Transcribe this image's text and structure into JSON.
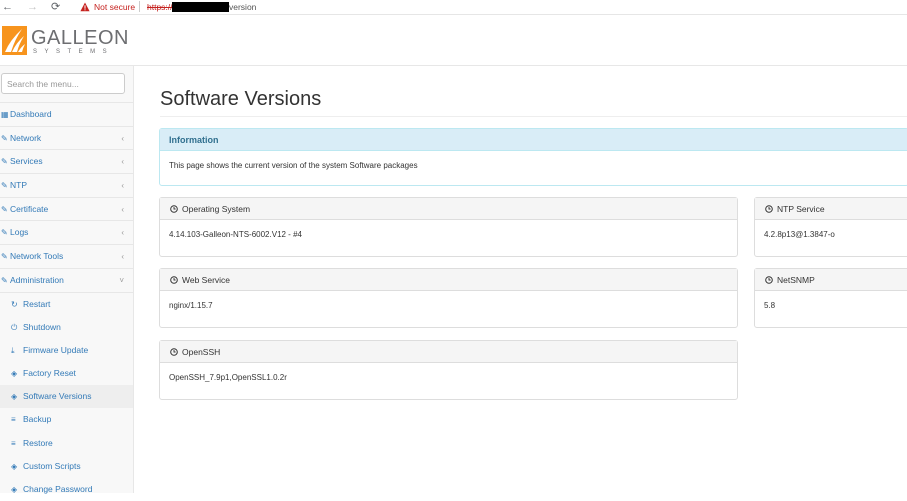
{
  "browser": {
    "back": "←",
    "forward": "→",
    "reload": "⟳",
    "not_secure": "Not secure",
    "url_scheme": "https://",
    "url_path": "version"
  },
  "logo": {
    "name": "GALLEON",
    "sub": "SYSTEMS"
  },
  "search": {
    "placeholder": "Search the menu..."
  },
  "menu": [
    {
      "label": "Dashboard",
      "icon": "dashboard-icon",
      "expandable": false
    },
    {
      "label": "Network",
      "icon": "wrench-icon",
      "expandable": true
    },
    {
      "label": "Services",
      "icon": "wrench-icon",
      "expandable": true
    },
    {
      "label": "NTP",
      "icon": "wrench-icon",
      "expandable": true
    },
    {
      "label": "Certificate",
      "icon": "wrench-icon",
      "expandable": true
    },
    {
      "label": "Logs",
      "icon": "wrench-icon",
      "expandable": true
    },
    {
      "label": "Network Tools",
      "icon": "wrench-icon",
      "expandable": true
    },
    {
      "label": "Administration",
      "icon": "wrench-icon",
      "expandable": true,
      "expanded": true
    }
  ],
  "submenu": [
    {
      "label": "Restart",
      "icon": "refresh-icon"
    },
    {
      "label": "Shutdown",
      "icon": "power-icon"
    },
    {
      "label": "Firmware Update",
      "icon": "download-icon"
    },
    {
      "label": "Factory Reset",
      "icon": "cube-icon"
    },
    {
      "label": "Software Versions",
      "icon": "cube-icon",
      "active": true
    },
    {
      "label": "Backup",
      "icon": "database-icon"
    },
    {
      "label": "Restore",
      "icon": "database-icon"
    },
    {
      "label": "Custom Scripts",
      "icon": "cube-icon"
    },
    {
      "label": "Change Password",
      "icon": "cube-icon"
    }
  ],
  "page": {
    "title": "Software Versions",
    "info_heading": "Information",
    "info_text": "This page shows the current version of the system Software packages"
  },
  "cards": {
    "os": {
      "title": "Operating System",
      "value": "4.14.103-Galleon-NTS-6002.V12 - #4"
    },
    "ntp": {
      "title": "NTP Service",
      "value": "4.2.8p13@1.3847-o"
    },
    "web": {
      "title": "Web Service",
      "value": "nginx/1.15.7"
    },
    "snmp": {
      "title": "NetSNMP",
      "value": "5.8"
    },
    "ssh": {
      "title": "OpenSSH",
      "value": "OpenSSH_7.9p1,OpenSSL1.0.2r"
    }
  },
  "colors": {
    "link": "#337ab7",
    "info_bg": "#d9edf7",
    "info_text": "#31708f",
    "logo_orange": "#f7941d"
  }
}
